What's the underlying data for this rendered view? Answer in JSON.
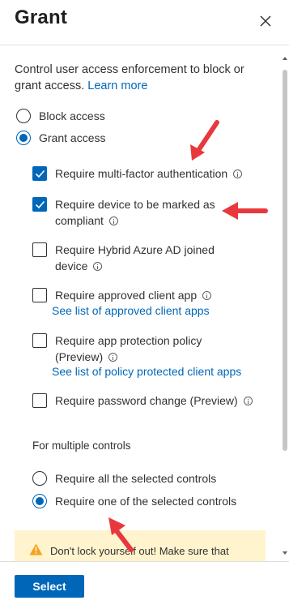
{
  "panel": {
    "title": "Grant",
    "description": "Control user access enforcement to block or grant access.",
    "learn_more": "Learn more"
  },
  "access": {
    "options": [
      {
        "label": "Block access",
        "checked": false
      },
      {
        "label": "Grant access",
        "checked": true
      }
    ]
  },
  "controls": [
    {
      "label": "Require multi-factor authentication",
      "checked": true,
      "info": true
    },
    {
      "label": "Require device to be marked as compliant",
      "checked": true,
      "info": true
    },
    {
      "label": "Require Hybrid Azure AD joined device",
      "checked": false,
      "info": true
    },
    {
      "label": "Require approved client app",
      "checked": false,
      "info": true,
      "link": "See list of approved client apps"
    },
    {
      "label": "Require app protection policy (Preview)",
      "checked": false,
      "info": true,
      "link": "See list of policy protected client apps"
    },
    {
      "label": "Require password change (Preview)",
      "checked": false,
      "info": true
    }
  ],
  "multiple_controls": {
    "label": "For multiple controls",
    "options": [
      {
        "label": "Require all the selected controls",
        "checked": false
      },
      {
        "label": "Require one of the selected controls",
        "checked": true
      }
    ]
  },
  "warning": {
    "text": "Don't lock yourself out! Make sure that"
  },
  "footer": {
    "select_label": "Select"
  },
  "colors": {
    "accent": "#0067b8",
    "warning_bg": "#fff4ce",
    "annotation_arrow": "#e8383d"
  }
}
